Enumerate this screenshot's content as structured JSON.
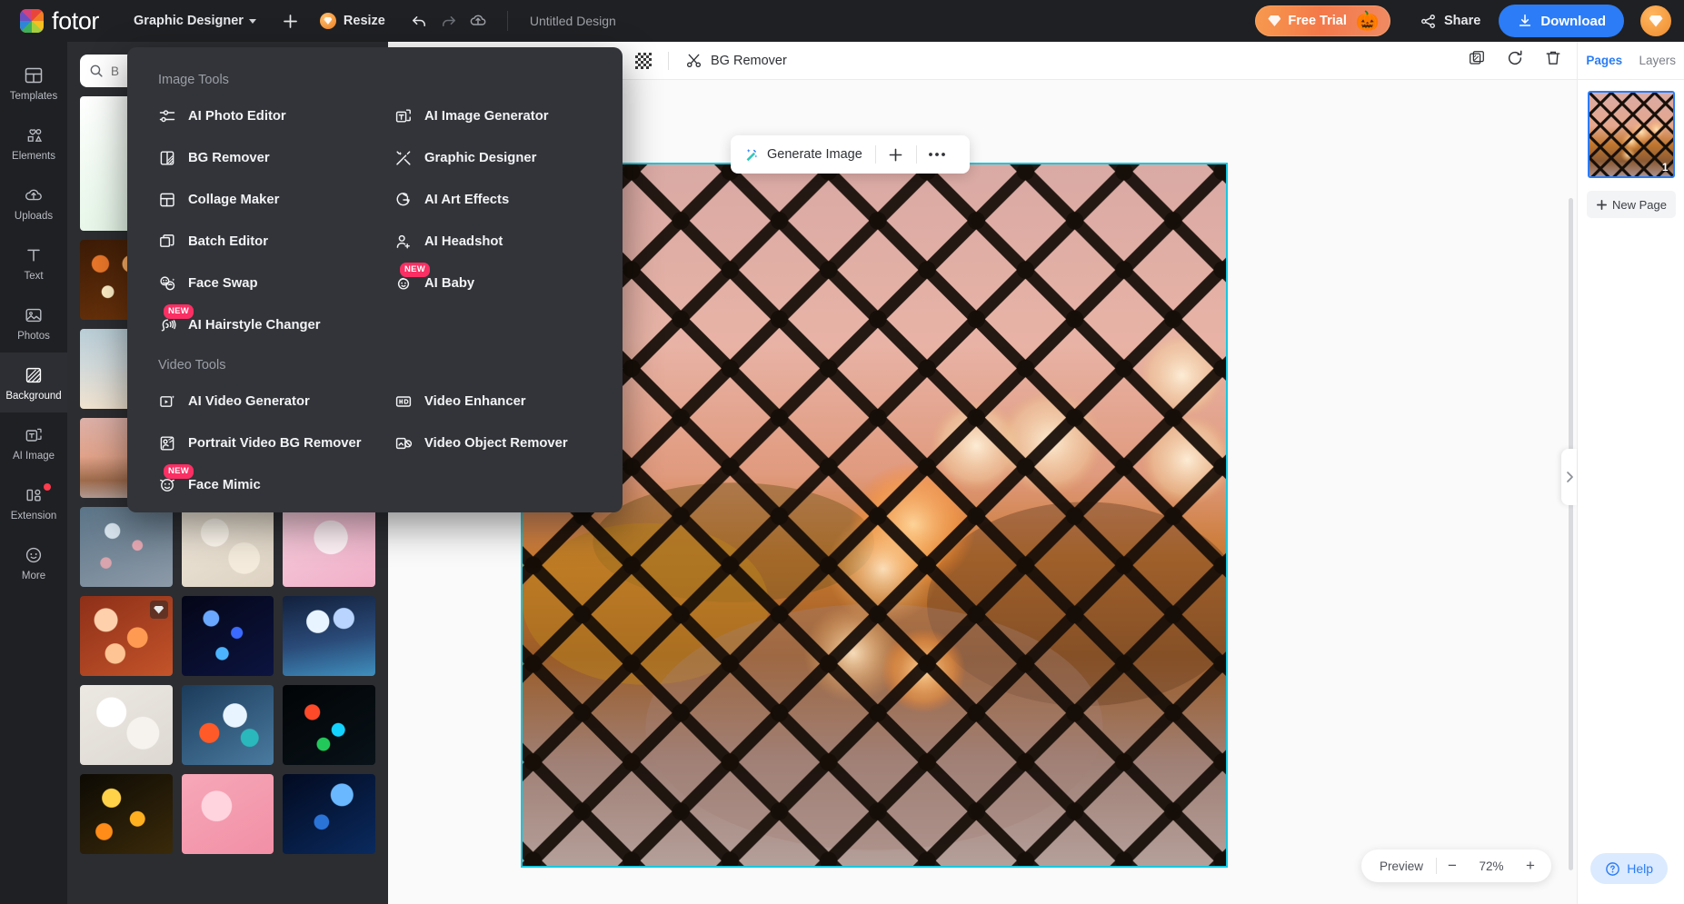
{
  "topbar": {
    "brand": "fotor",
    "product_menu": "Graphic Designer",
    "add_label": "+",
    "resize_label": "Resize",
    "undo_icon": "undo-icon",
    "redo_icon": "redo-icon",
    "cloud_icon": "cloud-upload-icon",
    "doc_title": "Untitled Design",
    "free_trial_label": "Free Trial",
    "free_trial_emoji": "🎃",
    "share_label": "Share",
    "download_label": "Download",
    "accent_blue": "#2b7cf6",
    "trial_orange": "#f4794a"
  },
  "rail": {
    "items": [
      {
        "label": "Templates",
        "icon": "templates-icon",
        "active": false
      },
      {
        "label": "Elements",
        "icon": "elements-icon",
        "active": false
      },
      {
        "label": "Uploads",
        "icon": "uploads-icon",
        "active": false
      },
      {
        "label": "Text",
        "icon": "text-icon",
        "active": false
      },
      {
        "label": "Photos",
        "icon": "photos-icon",
        "active": false
      },
      {
        "label": "Background",
        "icon": "background-icon",
        "active": true
      },
      {
        "label": "AI Image",
        "icon": "ai-image-icon",
        "active": false
      },
      {
        "label": "Extension",
        "icon": "extension-icon",
        "active": false,
        "dot": true
      },
      {
        "label": "More",
        "icon": "more-icon",
        "active": false
      }
    ]
  },
  "panel": {
    "search_placeholder": "B",
    "search_value": ""
  },
  "menu": {
    "section_image": "Image Tools",
    "section_video": "Video Tools",
    "image_tools": [
      {
        "label": "AI Photo Editor",
        "icon": "sliders-icon",
        "new": false
      },
      {
        "label": "AI Image Generator",
        "icon": "image-generator-icon",
        "new": false
      },
      {
        "label": "BG Remover",
        "icon": "bg-remover-icon",
        "new": false
      },
      {
        "label": "Graphic Designer",
        "icon": "graphic-designer-icon",
        "new": false
      },
      {
        "label": "Collage Maker",
        "icon": "collage-icon",
        "new": false
      },
      {
        "label": "AI Art Effects",
        "icon": "art-effects-icon",
        "new": false
      },
      {
        "label": "Batch Editor",
        "icon": "batch-editor-icon",
        "new": false
      },
      {
        "label": "AI Headshot",
        "icon": "headshot-icon",
        "new": false
      },
      {
        "label": "Face Swap",
        "icon": "face-swap-icon",
        "new": false
      },
      {
        "label": "AI Baby",
        "icon": "ai-baby-icon",
        "new": true
      },
      {
        "label": "AI Hairstyle Changer",
        "icon": "hairstyle-icon",
        "new": true
      },
      {
        "label": "",
        "icon": "",
        "new": false
      }
    ],
    "video_tools": [
      {
        "label": "AI Video Generator",
        "icon": "video-generator-icon",
        "new": false
      },
      {
        "label": "Video Enhancer",
        "icon": "hd-icon",
        "new": false
      },
      {
        "label": "Portrait Video BG Remover",
        "icon": "portrait-bg-icon",
        "new": false
      },
      {
        "label": "Video Object Remover",
        "icon": "object-remover-icon",
        "new": false
      },
      {
        "label": "Face Mimic",
        "icon": "face-mimic-icon",
        "new": true
      },
      {
        "label": "",
        "icon": "",
        "new": false
      }
    ],
    "new_badge": "NEW"
  },
  "canvas_toolbar": {
    "transparency_icon": "checkerboard-icon",
    "tool_label": "BG Remover",
    "tool_icon": "scissors-icon",
    "right_icons": [
      "crop-icon",
      "refresh-icon",
      "trash-icon"
    ]
  },
  "float_toolbar": {
    "generate_label": "Generate Image",
    "generate_icon": "magic-wand-icon",
    "plus_label": "+",
    "more_label": "•••"
  },
  "zoom_bar": {
    "preview_label": "Preview",
    "minus_label": "−",
    "zoom_level": "72%",
    "plus_label": "+"
  },
  "right_panel": {
    "tabs": [
      {
        "label": "Pages",
        "active": true
      },
      {
        "label": "Layers",
        "active": false
      }
    ],
    "page_number": "1",
    "new_page_label": "New Page",
    "collapse_icon": "chevron-right-icon"
  },
  "help": {
    "label": "Help",
    "icon": "question-circle-icon"
  },
  "thumbnails": [
    {
      "type": "card-green",
      "tall": true
    },
    {
      "type": "card-green2",
      "tall": true
    },
    {
      "type": "card-green3",
      "tall": true
    },
    {
      "type": "bokeh-orange",
      "gem": false
    },
    {
      "type": "bokeh-warm-pale",
      "gem": false
    },
    {
      "type": "bokeh-dark-red",
      "gem": false
    },
    {
      "type": "bokeh-teal-pale",
      "gem": false
    },
    {
      "type": "bokeh-cream",
      "gem": false
    },
    {
      "type": "bokeh-pink-soft",
      "gem": false
    },
    {
      "type": "fence-sunset",
      "gem": false
    },
    {
      "type": "bokeh-beige",
      "gem": false
    },
    {
      "type": "bokeh-pink-hearts",
      "gem": false
    },
    {
      "type": "rain-blue",
      "gem": false
    },
    {
      "type": "bokeh-cream2",
      "gem": false
    },
    {
      "type": "bokeh-pink-light",
      "gem": false
    },
    {
      "type": "bokeh-orange-big",
      "gem": true
    },
    {
      "type": "bokeh-blue-dark",
      "gem": false
    },
    {
      "type": "bokeh-city-night",
      "gem": false
    },
    {
      "type": "bokeh-white-soft",
      "gem": false
    },
    {
      "type": "rain-color",
      "gem": false
    },
    {
      "type": "bokeh-neon",
      "gem": false
    },
    {
      "type": "rain-gold",
      "gem": false
    },
    {
      "type": "bokeh-rose",
      "gem": false
    },
    {
      "type": "bokeh-fiber-blue",
      "gem": false
    }
  ]
}
